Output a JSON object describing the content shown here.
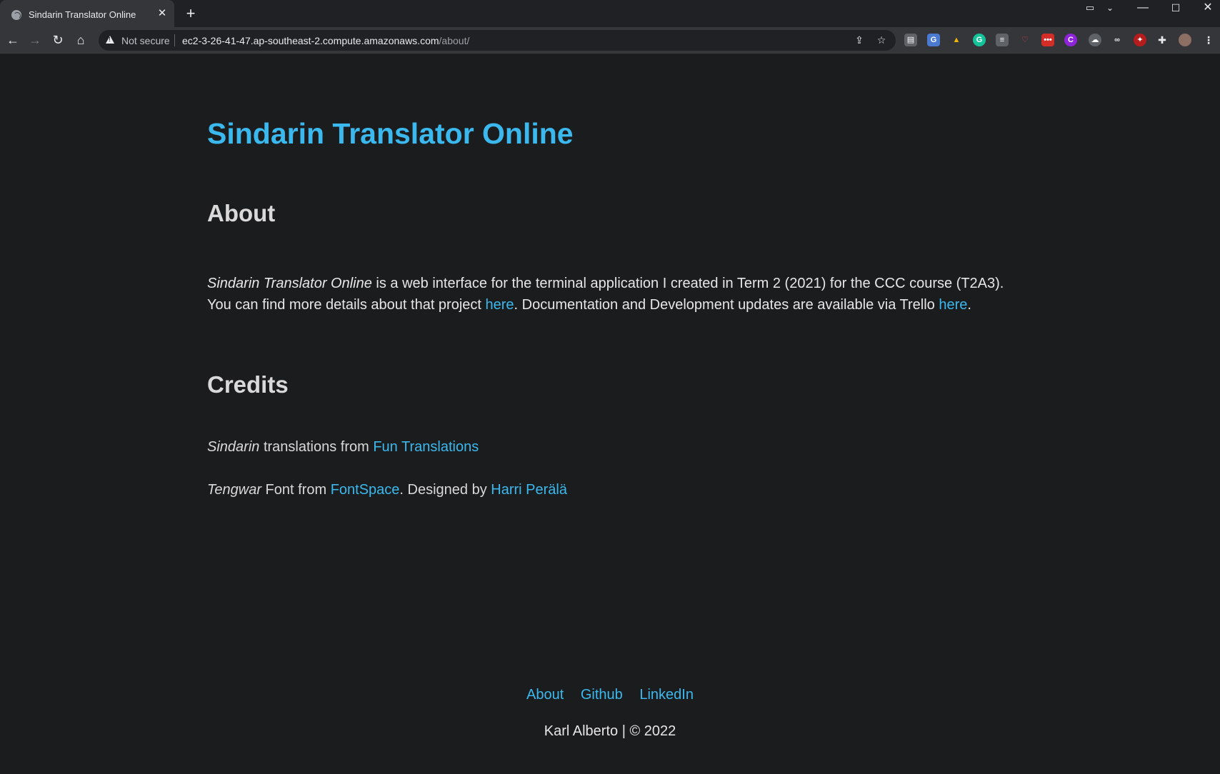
{
  "browser": {
    "tab_title": "Sindarin Translator Online",
    "security_label": "Not secure",
    "url_host": "ec2-3-26-41-47.ap-southeast-2.compute.amazonaws.com",
    "url_path": "/about/",
    "accent_color": "#3bb9ee",
    "extension_icons": [
      "extension-icon",
      "translate-icon",
      "drive-icon",
      "grammarly-icon",
      "notes-icon",
      "pocket-icon",
      "lastpass-icon",
      "c-extension-icon",
      "weather-icon",
      "glasses-icon",
      "red-extension-icon",
      "puzzle-icon",
      "avatar",
      "menu-icon"
    ]
  },
  "page": {
    "site_title": "Sindarin Translator Online",
    "about_heading": "About",
    "about": {
      "em_name": "Sindarin Translator Online",
      "text1": " is a web interface for the terminal application I created in Term 2 (2021) for the CCC course (T2A3). You can find more details about that project ",
      "link1": "here",
      "text2": ". Documentation and Development updates are available via Trello ",
      "link2": "here",
      "text3": "."
    },
    "credits_heading": "Credits",
    "credit1": {
      "em": "Sindarin",
      "text": " translations from ",
      "link": "Fun Translations"
    },
    "credit2": {
      "em": "Tengwar",
      "text": " Font from ",
      "link1": "FontSpace",
      "text2": ". Designed by ",
      "link2": "Harri Perälä"
    }
  },
  "footer": {
    "links": [
      "About",
      "Github",
      "LinkedIn"
    ],
    "copyright": "Karl Alberto | © 2022"
  }
}
